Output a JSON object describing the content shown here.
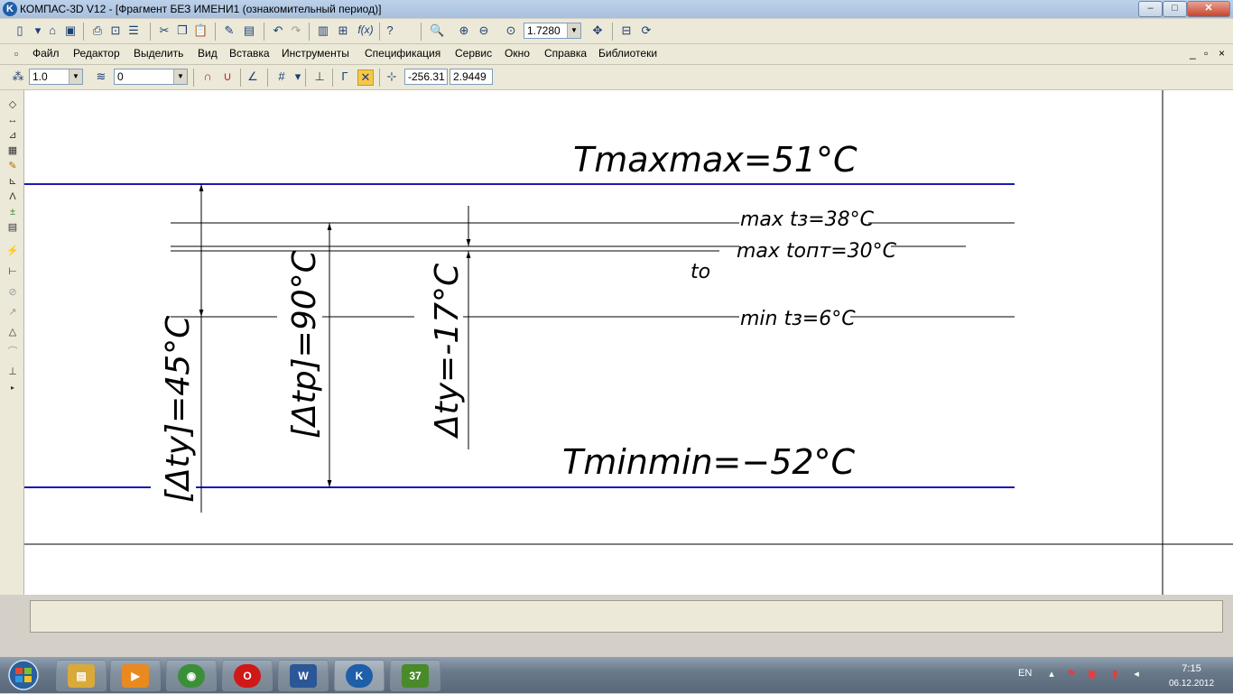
{
  "window": {
    "title": "КОМПАС-3D V12 - [Фрагмент БЕЗ ИМЕНИ1 (ознакомительный период)]",
    "app_icon_letter": "K",
    "min_glyph": "–",
    "max_glyph": "□",
    "close_glyph": "✕"
  },
  "standard_toolbar": {
    "zoom_value": "1.7280",
    "fx_label": "f(x)"
  },
  "menu": {
    "items": [
      "Файл",
      "Редактор",
      "Выделить",
      "Вид",
      "Вставка",
      "Инструменты",
      "Спецификация",
      "Сервис",
      "Окно",
      "Справка",
      "Библиотеки"
    ],
    "doc_min": "_",
    "doc_max": "▫",
    "doc_close": "×"
  },
  "current_state_toolbar": {
    "step_value": "1.0",
    "layer_value": "0",
    "cursor_x": "-256.31",
    "cursor_y": "2.9449"
  },
  "drawing": {
    "t_max": "Tmaxmax=51°C",
    "t_min": "Tminmin=−52°C",
    "max_t3": "max tз=38°C",
    "max_topt": "max tопт=30°C",
    "t0": "tо",
    "min_t3": "min tз=6°C",
    "delta_ty_allowed": "[Δty]=45°C",
    "delta_tp_allowed": "[Δtp]=90°C",
    "delta_ty": "Δty=-17°C"
  },
  "taskbar": {
    "lang": "EN",
    "time": "7:15",
    "date": "06.12.2012",
    "apps": [
      {
        "name": "explorer",
        "color": "#d9a93a",
        "glyph": "▤"
      },
      {
        "name": "media-player",
        "color": "#e88a20",
        "glyph": "▶"
      },
      {
        "name": "chrome",
        "color": "#3b8f3b",
        "glyph": "◉"
      },
      {
        "name": "opera",
        "color": "#d01818",
        "glyph": "O"
      },
      {
        "name": "word",
        "color": "#2b5797",
        "glyph": "W"
      },
      {
        "name": "kompas",
        "color": "#1f5ea8",
        "glyph": "K"
      },
      {
        "name": "media-center",
        "color": "#4a8a2a",
        "glyph": "37"
      }
    ]
  }
}
